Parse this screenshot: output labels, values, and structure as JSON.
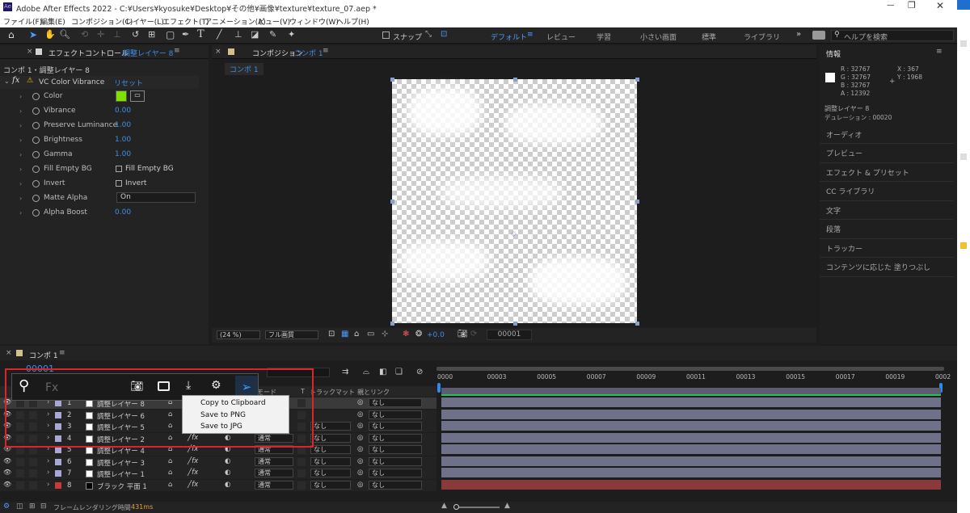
{
  "window": {
    "title": "Adobe After Effects 2022 - C:¥Users¥kyosuke¥Desktop¥その他¥画像¥texture¥texture_07.aep *"
  },
  "menu": [
    "ファイル(F)",
    "編集(E)",
    "コンポジション(C)",
    "レイヤー(L)",
    "エフェクト(T)",
    "アニメーション(A)",
    "ビュー(V)",
    "ウィンドウ(W)",
    "ヘルプ(H)"
  ],
  "toolbar": {
    "snap_label": "スナップ",
    "workspaces": [
      "デフォルト",
      "レビュー",
      "学習",
      "小さい画面",
      "標準",
      "ライブラリ"
    ],
    "help_placeholder": "ヘルプを検索"
  },
  "effect_panel": {
    "tab": "エフェクトコントロール",
    "layer": "調整レイヤー 8",
    "breadcrumb": "コンポ 1・調整レイヤー 8",
    "effect": "VC Color Vibrance",
    "reset": "リセット",
    "props": [
      {
        "name": "Color",
        "value": ""
      },
      {
        "name": "Vibrance",
        "value": "0.00"
      },
      {
        "name": "Preserve Luminance",
        "value": "1.00"
      },
      {
        "name": "Brightness",
        "value": "1.00"
      },
      {
        "name": "Gamma",
        "value": "1.00"
      },
      {
        "name": "Fill Empty BG",
        "value": "Fill Empty BG"
      },
      {
        "name": "Invert",
        "value": "Invert"
      },
      {
        "name": "Matte Alpha",
        "value": "On"
      },
      {
        "name": "Alpha Boost",
        "value": "0.00"
      }
    ],
    "color_swatch": "#7fe000"
  },
  "comp_panel": {
    "tab": "コンポジション",
    "comp": "コンポ 1",
    "subtab": "コンポ 1",
    "zoom": "(24 %)",
    "quality": "フル画質",
    "exposure": "+0.0",
    "timecode": "00001"
  },
  "info_panel": {
    "title": "情報",
    "r": "R : 32767",
    "g": "G : 32767",
    "b": "B : 32767",
    "a": "A : 12392",
    "x": "X : 367",
    "y": "Y : 1968",
    "layer": "調整レイヤー 8",
    "duration": "デュレーション : 00020",
    "sections": [
      "オーディオ",
      "プレビュー",
      "エフェクト & プリセット",
      "CC ライブラリ",
      "文字",
      "段落",
      "トラッカー",
      "コンテンツに応じた 塗りつぶし"
    ]
  },
  "timeline": {
    "tab": "コンポ 1",
    "timecode": "00001",
    "ticks": [
      "0000",
      "00003",
      "00005",
      "00007",
      "00009",
      "00011",
      "00013",
      "00015",
      "00017",
      "00019",
      "0002"
    ],
    "col_mode": "モード",
    "col_t": "T",
    "col_trackmatte": "トラックマット",
    "col_parent": "親とリンク",
    "layers": [
      {
        "num": "1",
        "name": "調整レイヤー 8",
        "mode": "",
        "track": "",
        "parent": "なし"
      },
      {
        "num": "2",
        "name": "調整レイヤー 6",
        "mode": "",
        "track": "",
        "parent": "なし"
      },
      {
        "num": "3",
        "name": "調整レイヤー 5",
        "mode": "",
        "track": "なし",
        "parent": "なし"
      },
      {
        "num": "4",
        "name": "調整レイヤー 2",
        "mode": "通常",
        "track": "なし",
        "parent": "なし"
      },
      {
        "num": "5",
        "name": "調整レイヤー 4",
        "mode": "通常",
        "track": "なし",
        "parent": "なし"
      },
      {
        "num": "6",
        "name": "調整レイヤー 3",
        "mode": "通常",
        "track": "なし",
        "parent": "なし"
      },
      {
        "num": "7",
        "name": "調整レイヤー 1",
        "mode": "通常",
        "track": "なし",
        "parent": "なし"
      },
      {
        "num": "8",
        "name": "ブラック 平面 1",
        "mode": "通常",
        "track": "なし",
        "parent": "なし"
      }
    ],
    "render_label": "フレームレンダリング時間",
    "render_time": "431ms"
  },
  "overlay": {
    "search_placeholder": "Fx",
    "menu": [
      "Copy to Clipboard",
      "Save to PNG",
      "Save to JPG"
    ]
  }
}
